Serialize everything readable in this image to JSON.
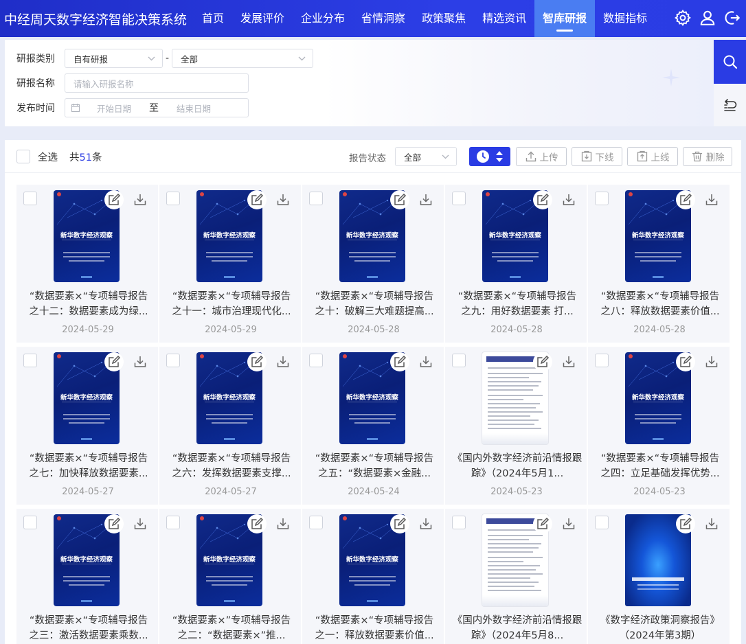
{
  "nav": {
    "app_title": "中经周天数字经济智能决策系统",
    "items": [
      {
        "label": "首页"
      },
      {
        "label": "发展评价"
      },
      {
        "label": "企业分布"
      },
      {
        "label": "省情洞察"
      },
      {
        "label": "政策聚焦"
      },
      {
        "label": "精选资讯"
      },
      {
        "label": "智库研报",
        "active": true
      },
      {
        "label": "数据指标"
      }
    ],
    "icons": [
      "gear-icon",
      "user-icon",
      "logout-icon"
    ]
  },
  "filter": {
    "category_label": "研报类别",
    "category_value": "自有研报",
    "separator": "-",
    "subcategory_value": "全部",
    "name_label": "研报名称",
    "name_placeholder": "请输入研报名称",
    "date_label": "发布时间",
    "start_placeholder": "开始日期",
    "date_to": "至",
    "end_placeholder": "结束日期"
  },
  "toolbar": {
    "select_all": "全选",
    "total_prefix": "共",
    "total_count": "51",
    "total_suffix": "条",
    "status_label": "报告状态",
    "status_value": "全部",
    "upload": "上传",
    "offline": "下线",
    "online": "上线",
    "delete": "删除"
  },
  "colors": {
    "primary": "#2a3ce4",
    "nav_active": "#4a7df2",
    "count": "#2a3ce4"
  },
  "reports": [
    {
      "title_line1": "“数据要素×“专项辅导报告",
      "title_line2": "之十二：数据要素成为绿...",
      "date": "2024-05-29",
      "cover": "series",
      "cover_title": "新华数字经济观察"
    },
    {
      "title_line1": "“数据要素×“专项辅导报告",
      "title_line2": "之十一：城市治理现代化...",
      "date": "2024-05-29",
      "cover": "series",
      "cover_title": "新华数字经济观察"
    },
    {
      "title_line1": "“数据要素×“专项辅导报告",
      "title_line2": "之十：破解三大难题提高...",
      "date": "2024-05-28",
      "cover": "series",
      "cover_title": "新华数字经济观察"
    },
    {
      "title_line1": "“数据要素×“专项辅导报告",
      "title_line2": "之九：用好数据要素 打...",
      "date": "2024-05-28",
      "cover": "series",
      "cover_title": "新华数字经济观察"
    },
    {
      "title_line1": "“数据要素×“专项辅导报告",
      "title_line2": "之八：释放数据要素价值...",
      "date": "2024-05-28",
      "cover": "series",
      "cover_title": "新华数字经济观察"
    },
    {
      "title_line1": "“数据要素×“专项辅导报告",
      "title_line2": "之七：加快释放数据要素...",
      "date": "2024-05-27",
      "cover": "series",
      "cover_title": "新华数字经济观察"
    },
    {
      "title_line1": "“数据要素×“专项辅导报告",
      "title_line2": "之六：发挥数据要素支撑...",
      "date": "2024-05-27",
      "cover": "series",
      "cover_title": "新华数字经济观察"
    },
    {
      "title_line1": "“数据要素×“专项辅导报告",
      "title_line2": "之五：“数据要素×金融...",
      "date": "2024-05-24",
      "cover": "series",
      "cover_title": "新华数字经济观察"
    },
    {
      "title_line1": "《国内外数字经济前沿情报跟",
      "title_line2": "踪》（2024年5月1...",
      "date": "2024-05-23",
      "cover": "doc"
    },
    {
      "title_line1": "“数据要素×“专项辅导报告",
      "title_line2": "之四：立足基础发挥优势...",
      "date": "2024-05-23",
      "cover": "series",
      "cover_title": "新华数字经济观察"
    },
    {
      "title_line1": "“数据要素×“专项辅导报告",
      "title_line2": "之三：激活数据要素乘数...",
      "date": "",
      "cover": "series",
      "cover_title": "新华数字经济观察"
    },
    {
      "title_line1": "“数据要素×”专项辅导报告",
      "title_line2": "之二：“数据要素×”推...",
      "date": "",
      "cover": "series",
      "cover_title": "新华数字经济观察"
    },
    {
      "title_line1": "“数据要素×“专项辅导报告",
      "title_line2": "之一：释放数据要素价值...",
      "date": "",
      "cover": "series",
      "cover_title": "新华数字经济观察"
    },
    {
      "title_line1": "《国内外数字经济前沿情报跟",
      "title_line2": "踪》（2024年5月8...",
      "date": "",
      "cover": "doc"
    },
    {
      "title_line1": "《数字经济政策洞察报告》",
      "title_line2": "（2024年第3期）",
      "date": "",
      "cover": "glow"
    }
  ]
}
